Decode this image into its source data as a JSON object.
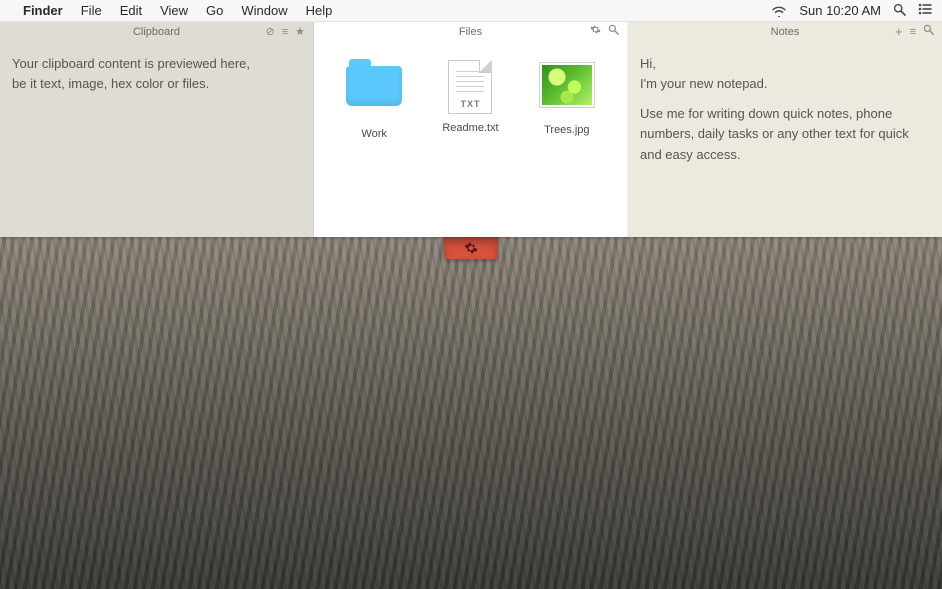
{
  "menubar": {
    "app": "Finder",
    "items": [
      "File",
      "Edit",
      "View",
      "Go",
      "Window",
      "Help"
    ],
    "clock": "Sun 10:20 AM"
  },
  "clipboard": {
    "title": "Clipboard",
    "body_line1": "Your clipboard content is previewed here,",
    "body_line2": "be it text, image, hex color or files.",
    "icons": {
      "clear": "⊘",
      "list": "≡",
      "star": "★"
    }
  },
  "files": {
    "title": "Files",
    "icons": {
      "settings": "⚙",
      "search": "🔍"
    },
    "items": [
      {
        "name": "Work",
        "kind": "folder"
      },
      {
        "name": "Readme.txt",
        "kind": "txt",
        "ext": "TXT"
      },
      {
        "name": "Trees.jpg",
        "kind": "image"
      }
    ]
  },
  "notes": {
    "title": "Notes",
    "icons": {
      "add": "+",
      "list": "≡",
      "search": "🔍"
    },
    "line1": "Hi,",
    "line2": "I'm your new notepad.",
    "line3": "Use me for writing down quick notes, phone numbers, daily tasks or any other text for quick and easy access."
  }
}
